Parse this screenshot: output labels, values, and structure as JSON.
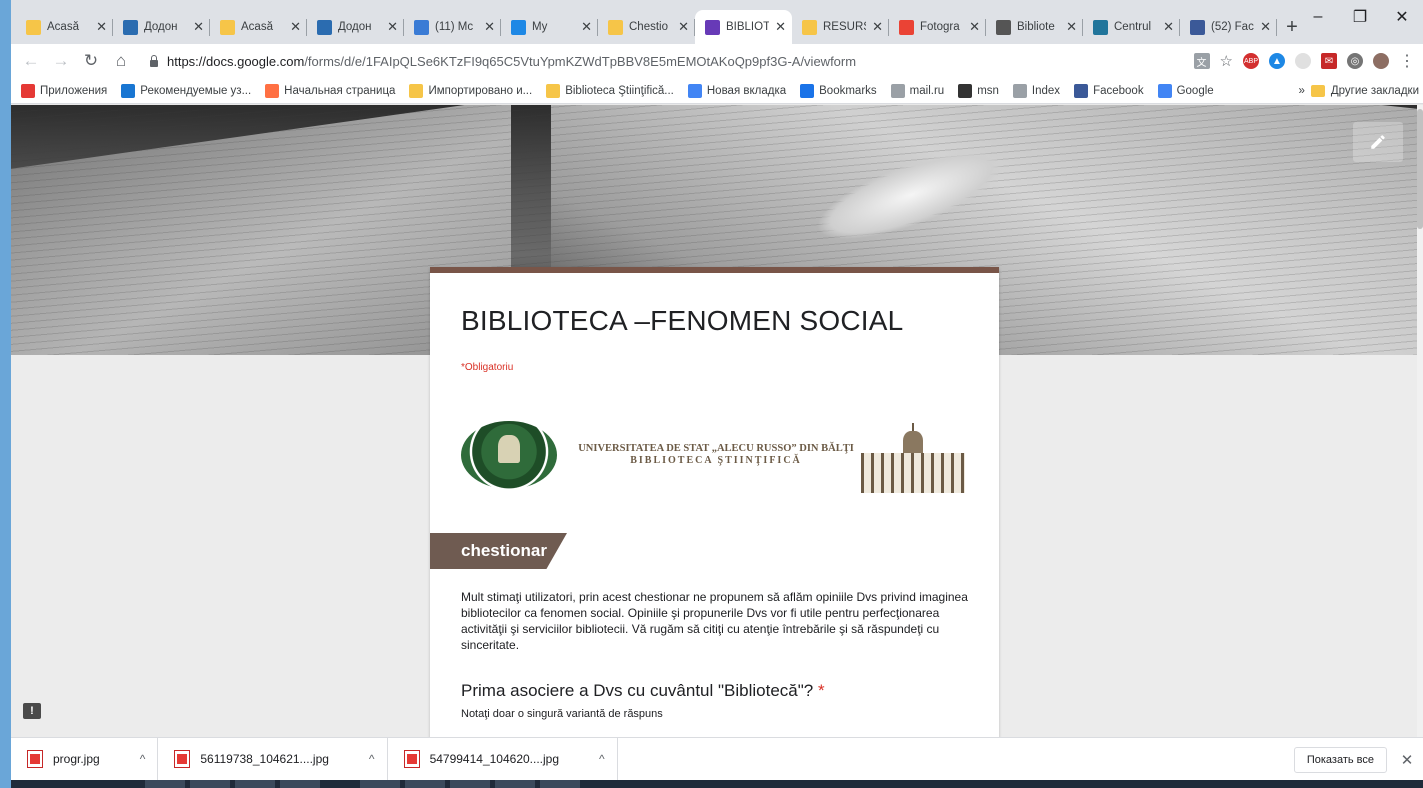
{
  "tabs": [
    {
      "title": "Acasă",
      "fav": "note-icon",
      "color": "#f6c548",
      "active": false
    },
    {
      "title": "Додон",
      "fav": "globe-icon",
      "color": "#2b6cb0",
      "active": false
    },
    {
      "title": "Acasă",
      "fav": "note-icon",
      "color": "#f6c548",
      "active": false
    },
    {
      "title": "Додон",
      "fav": "globe-icon",
      "color": "#2b6cb0",
      "active": false
    },
    {
      "title": "(11) Mc",
      "fav": "chat-icon",
      "color": "#3a7bd5",
      "active": false
    },
    {
      "title": "My",
      "fav": "play-icon",
      "color": "#1e88e5",
      "active": false
    },
    {
      "title": "Chestio",
      "fav": "note-icon",
      "color": "#f6c548",
      "active": false
    },
    {
      "title": "BIBLIOT",
      "fav": "forms-icon",
      "color": "#673ab7",
      "active": true
    },
    {
      "title": "RESURS",
      "fav": "note-icon",
      "color": "#f6c548",
      "active": false
    },
    {
      "title": "Fotogra",
      "fav": "pinwheel-icon",
      "color": "#ea4335",
      "active": false
    },
    {
      "title": "Bibliote",
      "fav": "wikipedia-icon",
      "color": "#555555",
      "active": false
    },
    {
      "title": "Centrul",
      "fav": "wordpress-icon",
      "color": "#21759b",
      "active": false
    },
    {
      "title": "(52) Fac",
      "fav": "facebook-icon",
      "color": "#3b5998",
      "active": false
    }
  ],
  "address": {
    "host": "https://docs.google.com",
    "path": "/forms/d/e/1FAIpQLSe6KTzFI9q65C5VtuYpmKZWdTpBBV8E5mEMOtAKoQp9pf3G-A/viewform"
  },
  "bookmarks": [
    {
      "label": "Приложения",
      "icon": "apps-icon",
      "color": "#e53935"
    },
    {
      "label": "Рекомендуемые уз...",
      "icon": "ie-icon",
      "color": "#1976d2"
    },
    {
      "label": "Начальная страница",
      "icon": "firefox-icon",
      "color": "#ff7043"
    },
    {
      "label": "Импортировано и...",
      "icon": "folder-icon",
      "color": "#f6c548"
    },
    {
      "label": "Biblioteca Ştiinţifică...",
      "icon": "note-icon",
      "color": "#f6c548"
    },
    {
      "label": "Новая вкладка",
      "icon": "google-icon",
      "color": "#4285f4"
    },
    {
      "label": "Bookmarks",
      "icon": "star-icon",
      "color": "#1a73e8"
    },
    {
      "label": "mail.ru",
      "icon": "page-icon",
      "color": "#9aa0a6"
    },
    {
      "label": "msn",
      "icon": "msn-icon",
      "color": "#333333"
    },
    {
      "label": "Index",
      "icon": "page-icon",
      "color": "#9aa0a6"
    },
    {
      "label": "Facebook",
      "icon": "facebook-icon",
      "color": "#3b5998"
    },
    {
      "label": "Google",
      "icon": "google-icon",
      "color": "#4285f4"
    }
  ],
  "bookmarks_more": "»",
  "other_bookmarks": "Другие закладки",
  "form": {
    "title": "BIBLIOTECA –FENOMEN SOCIAL",
    "required_note": "*Obligatoriu",
    "university_line1": "UNIVERSITATEA DE STAT „ALECU RUSSO” DIN BĂLŢI",
    "university_line2": "BIBLIOTECA ŞTIINŢIFICĂ",
    "section_title": "chestionar",
    "description": "Mult stimaţi utilizatori, prin acest chestionar ne propunem să aflăm opiniile Dvs privind imaginea bibliotecilor ca fenomen social. Opiniile şi propunerile Dvs vor fi utile pentru perfecţionarea activităţii şi serviciilor bibliotecii. Vă rugăm să citiţi cu atenţie întrebările şi să răspundeţi cu sinceritate.",
    "question_title": "Prima asociere a Dvs cu cuvântul \"Bibliotecă\"?",
    "question_star": "*",
    "question_help": "Notaţi doar o singură variantă de răspuns"
  },
  "downloads": [
    {
      "name": "progr.jpg"
    },
    {
      "name": "56119738_104621....jpg"
    },
    {
      "name": "54799414_104620....jpg"
    }
  ],
  "downloads_show_all": "Показать все",
  "colors": {
    "accent": "#795548",
    "section": "#6f5b51",
    "required": "#d93025"
  }
}
